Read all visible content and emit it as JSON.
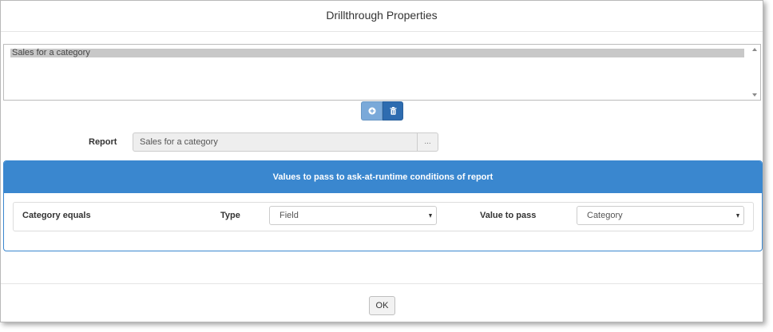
{
  "dialog": {
    "title": "Drillthrough Properties"
  },
  "drillthrough_list": {
    "items": [
      {
        "label": "Sales for a category",
        "selected": true
      }
    ]
  },
  "list_buttons": {
    "add_icon": "plus-circle-icon",
    "delete_icon": "trash-icon"
  },
  "report": {
    "label": "Report",
    "value": "Sales for a category",
    "browse_label": "..."
  },
  "conditions_panel": {
    "heading": "Values to pass to ask-at-runtime conditions of report",
    "rows": [
      {
        "condition": "Category equals",
        "type_label": "Type",
        "type_value": "Field",
        "value_label": "Value to pass",
        "value_value": "Category"
      }
    ]
  },
  "footer": {
    "ok_label": "OK"
  },
  "colors": {
    "panel_blue": "#3a87cf",
    "add_button": "#7aa9d9",
    "delete_button": "#2e6cb0"
  }
}
